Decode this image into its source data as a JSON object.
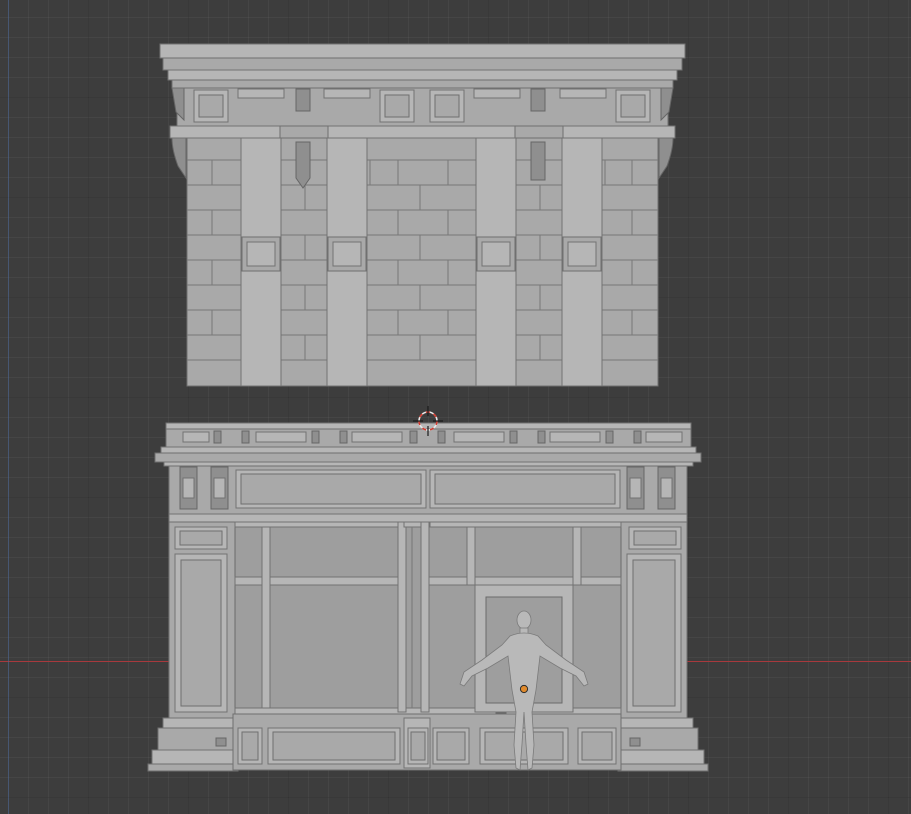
{
  "viewport": {
    "colors": {
      "background": "#3d3d3d",
      "x_axis": "#a8393d",
      "y_axis": "#4a6da8",
      "cursor_ring": "#e8e8e8",
      "cursor_dash": "#d23b30",
      "origin": "#e08a2c"
    }
  },
  "icons": {
    "cursor": "3d-cursor-icon",
    "origin": "object-origin-icon"
  }
}
